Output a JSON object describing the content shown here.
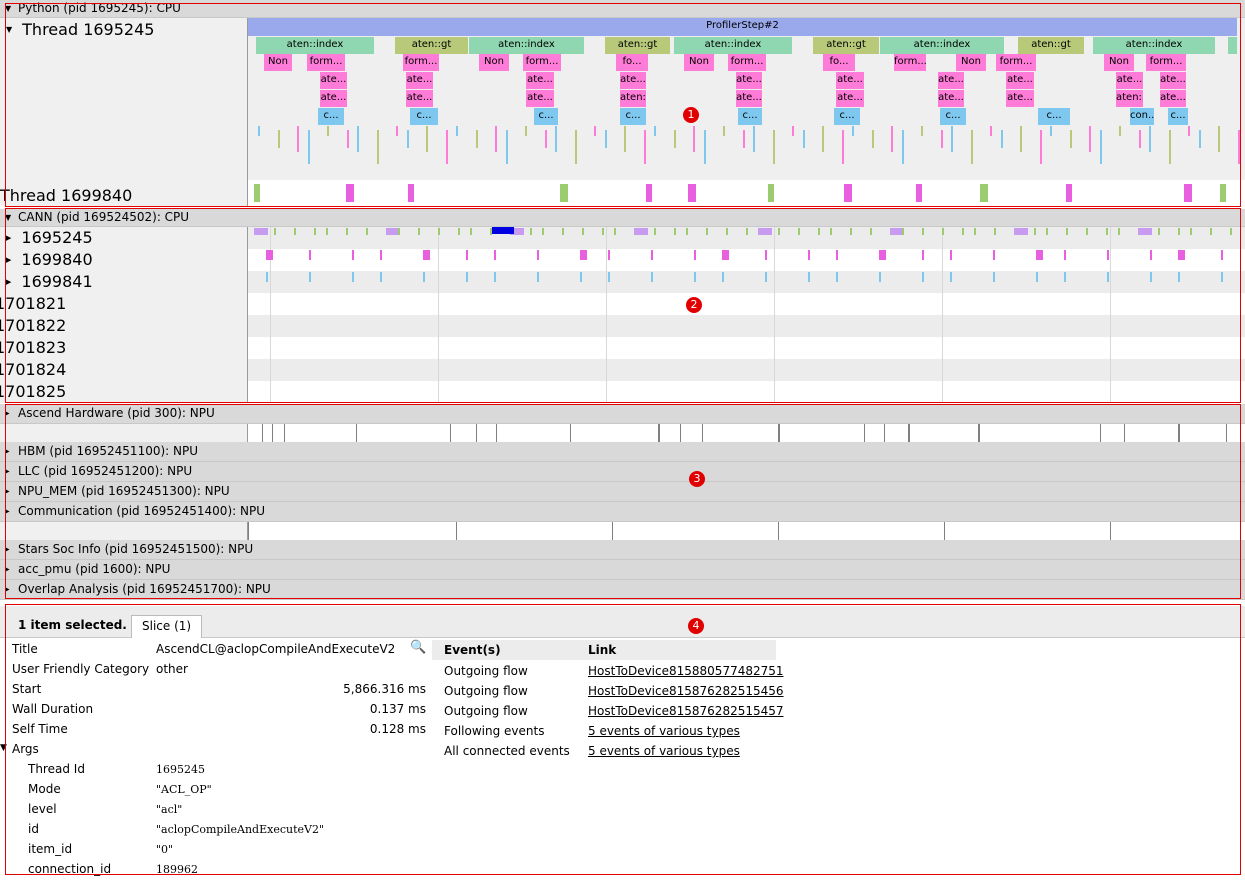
{
  "section1": {
    "process_label": "Python (pid 1695245): CPU",
    "thread_a": "Thread 1695245",
    "thread_b": "Thread 1699840",
    "profiler_step": "ProfilerStep#2",
    "marker": "1",
    "slice_labels": {
      "index": "aten::index",
      "gt": "aten::gt",
      "non": "Non",
      "form": "form...",
      "fo": "fo...",
      "ate": "ate...",
      "aten": "aten:...",
      "c": "c...",
      "con": "con..."
    }
  },
  "section2": {
    "process_label": "CANN (pid 169524502): CPU",
    "threads": [
      "1695245",
      "1699840",
      "1699841",
      "1701821",
      "1701822",
      "1701823",
      "1701824",
      "1701825"
    ],
    "marker": "2"
  },
  "section3": {
    "processes": [
      "Ascend Hardware (pid 300): NPU",
      "HBM (pid 16952451100): NPU",
      "LLC (pid 16952451200): NPU",
      "NPU_MEM (pid 16952451300): NPU",
      "Communication (pid 16952451400): NPU",
      "Stars Soc Info (pid 16952451500): NPU",
      "acc_pmu (pid 1600): NPU",
      "Overlap Analysis (pid 16952451700): NPU"
    ],
    "marker": "3"
  },
  "details": {
    "marker": "4",
    "selected_text": "1 item selected.",
    "tab_label": "Slice (1)",
    "rows": {
      "title_label": "Title",
      "title_value": "AscendCL@aclopCompileAndExecuteV2",
      "category_label": "User Friendly Category",
      "category_value": "other",
      "start_label": "Start",
      "start_value": "5,866.316 ms",
      "wall_label": "Wall Duration",
      "wall_value": "0.137 ms",
      "self_label": "Self Time",
      "self_value": "0.128 ms",
      "args_label": "Args"
    },
    "args": [
      {
        "key": "Thread Id",
        "value": "1695245"
      },
      {
        "key": "Mode",
        "value": "\"ACL_OP\""
      },
      {
        "key": "level",
        "value": "\"acl\""
      },
      {
        "key": "id",
        "value": "\"aclopCompileAndExecuteV2\""
      },
      {
        "key": "item_id",
        "value": "\"0\""
      },
      {
        "key": "connection_id",
        "value": "189962"
      }
    ],
    "events_header": "Event(s)",
    "link_header": "Link",
    "events": [
      {
        "event": "Outgoing flow",
        "link": "HostToDevice815880577482751"
      },
      {
        "event": "Outgoing flow",
        "link": "HostToDevice815876282515456"
      },
      {
        "event": "Outgoing flow",
        "link": "HostToDevice815876282515457"
      },
      {
        "event": "Following events",
        "link": "5 events of various types"
      },
      {
        "event": "All connected events",
        "link": "5 events of various types"
      }
    ]
  },
  "colors": {
    "index": "#8ed7b0",
    "gt": "#b8c97a",
    "non": "#ff7bd8",
    "form": "#ff7bd8",
    "c": "#7ec8f0",
    "step": "#9aa8ec",
    "pink_bar": "#e860e0",
    "green_bar": "#9ccc70",
    "purple_bar": "#c79cf0",
    "selected_blue": "#0000e0"
  }
}
